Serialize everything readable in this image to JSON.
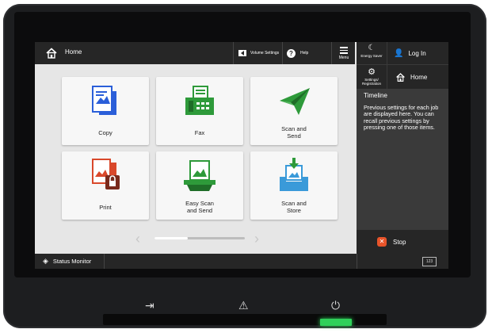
{
  "topbar": {
    "title": "Home",
    "volume_label": "Volume Settings",
    "help_label": "Help",
    "menu_label": "Menu"
  },
  "right_panel": {
    "energy_label": "Energy Saver",
    "login_label": "Log In",
    "settings_label_1": "Settings/",
    "settings_label_2": "Registration",
    "home_label": "Home",
    "timeline_title": "Timeline",
    "timeline_text": "Previous settings for each job are displayed here. You can recall previous settings by pressing one of those items.",
    "stop_label": "Stop"
  },
  "tiles": [
    {
      "label": "Copy",
      "icon": "copy-icon"
    },
    {
      "label": "Fax",
      "icon": "fax-icon"
    },
    {
      "label": "Scan and\nSend",
      "icon": "scan-send-icon"
    },
    {
      "label": "Print",
      "icon": "print-icon"
    },
    {
      "label": "Easy Scan\nand Send",
      "icon": "easy-scan-icon"
    },
    {
      "label": "Scan and\nStore",
      "icon": "scan-store-icon"
    }
  ],
  "pager": {
    "progress": 0.37
  },
  "bottombar": {
    "status_label": "Status Monitor",
    "keyboard_label": "123"
  },
  "colors": {
    "blue": "#2b5fd9",
    "green": "#2e9a3a",
    "red": "#d9482b",
    "sky": "#3a9ad9",
    "dark": "#262626",
    "led": "#2fd05a"
  }
}
